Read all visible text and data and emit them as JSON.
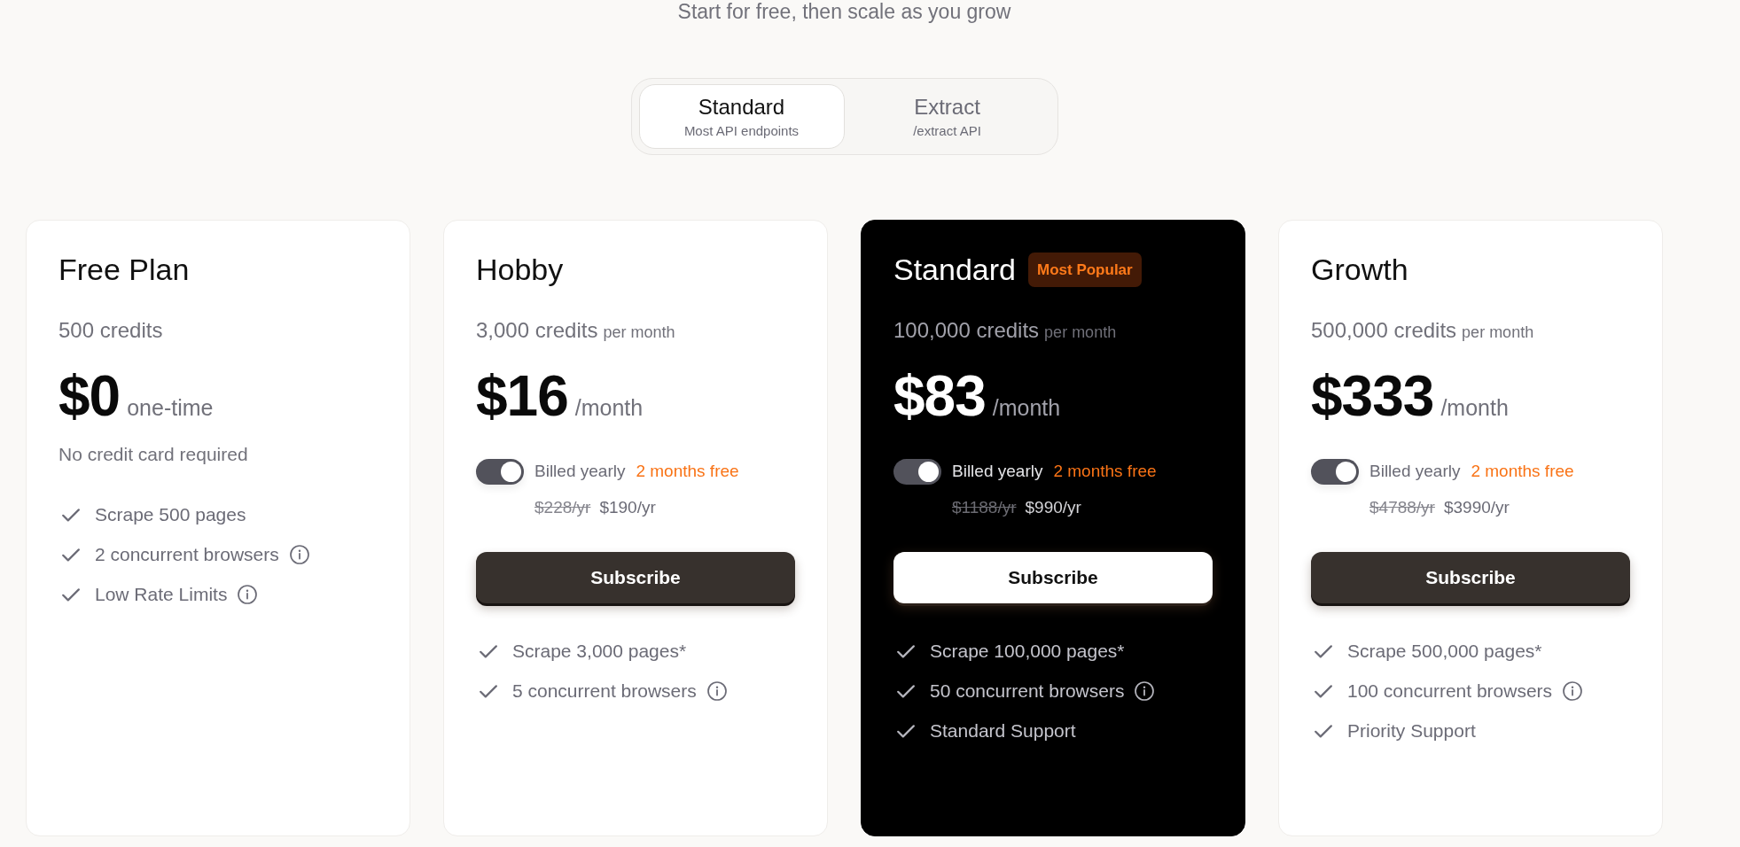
{
  "header": {
    "subtitle": "Start for free, then scale as you grow"
  },
  "tabs": [
    {
      "label": "Standard",
      "description": "Most API endpoints",
      "selected": true
    },
    {
      "label": "Extract",
      "description": "/extract API",
      "selected": false
    }
  ],
  "plans": [
    {
      "name": "Free Plan",
      "featured": false,
      "credits": "500 credits",
      "price": "$0",
      "price_unit": "one-time",
      "note": "No credit card required",
      "features": [
        {
          "text": "Scrape 500 pages",
          "info": false
        },
        {
          "text": "2 concurrent browsers",
          "info": true
        },
        {
          "text": "Low Rate Limits",
          "info": true
        }
      ]
    },
    {
      "name": "Hobby",
      "featured": false,
      "credits": "3,000 credits",
      "credits_period": "per month",
      "price": "$16",
      "price_unit": "/month",
      "billing": {
        "on": true,
        "label": "Billed yearly",
        "offer": "2 months free",
        "old_price": "$228/yr",
        "new_price": "$190/yr"
      },
      "button": "Subscribe",
      "features": [
        {
          "text": "Scrape 3,000 pages*",
          "info": false
        },
        {
          "text": "5 concurrent browsers",
          "info": true
        }
      ]
    },
    {
      "name": "Standard",
      "featured": true,
      "badge": "Most Popular",
      "credits": "100,000 credits",
      "credits_period": "per month",
      "price": "$83",
      "price_unit": "/month",
      "billing": {
        "on": true,
        "label": "Billed yearly",
        "offer": "2 months free",
        "old_price": "$1188/yr",
        "new_price": "$990/yr"
      },
      "button": "Subscribe",
      "features": [
        {
          "text": "Scrape 100,000 pages*",
          "info": false
        },
        {
          "text": "50 concurrent browsers",
          "info": true
        },
        {
          "text": "Standard Support",
          "info": false
        }
      ]
    },
    {
      "name": "Growth",
      "featured": false,
      "credits": "500,000 credits",
      "credits_period": "per month",
      "price": "$333",
      "price_unit": "/month",
      "billing": {
        "on": true,
        "label": "Billed yearly",
        "offer": "2 months free",
        "old_price": "$4788/yr",
        "new_price": "$3990/yr"
      },
      "button": "Subscribe",
      "features": [
        {
          "text": "Scrape 500,000 pages*",
          "info": false
        },
        {
          "text": "100 concurrent browsers",
          "info": true
        },
        {
          "text": "Priority Support",
          "info": false
        }
      ]
    }
  ]
}
